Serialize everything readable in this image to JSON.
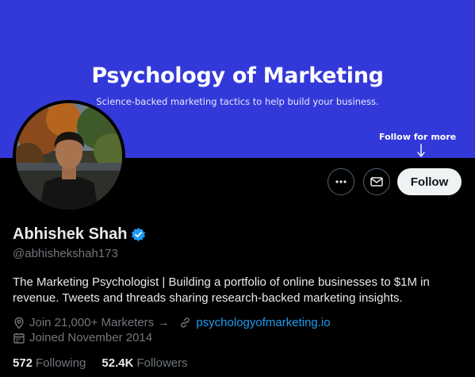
{
  "banner": {
    "title": "Psychology of Marketing",
    "subtitle": "Science-backed marketing tactics to help build your business.",
    "cta": "Follow for more",
    "background_color": "#3339d9"
  },
  "actions": {
    "more_icon": "more-horizontal-icon",
    "message_icon": "envelope-icon",
    "follow_label": "Follow"
  },
  "profile": {
    "name": "Abhishek Shah",
    "verified_icon": "verified-badge-icon",
    "verified_color": "#1d9bf0",
    "handle": "@abhishekshah173",
    "bio": "The Marketing Psychologist | Building a portfolio of online businesses to $1M in revenue. Tweets and threads sharing research-backed marketing insights.",
    "location": "Join 21,000+ Marketers →",
    "location_icon": "location-pin-icon",
    "website": "psychologyofmarketing.io",
    "website_icon": "link-icon",
    "joined": "Joined November 2014",
    "joined_icon": "calendar-icon"
  },
  "stats": {
    "following_count": "572",
    "following_label": "Following",
    "followers_count": "52.4K",
    "followers_label": "Followers"
  }
}
